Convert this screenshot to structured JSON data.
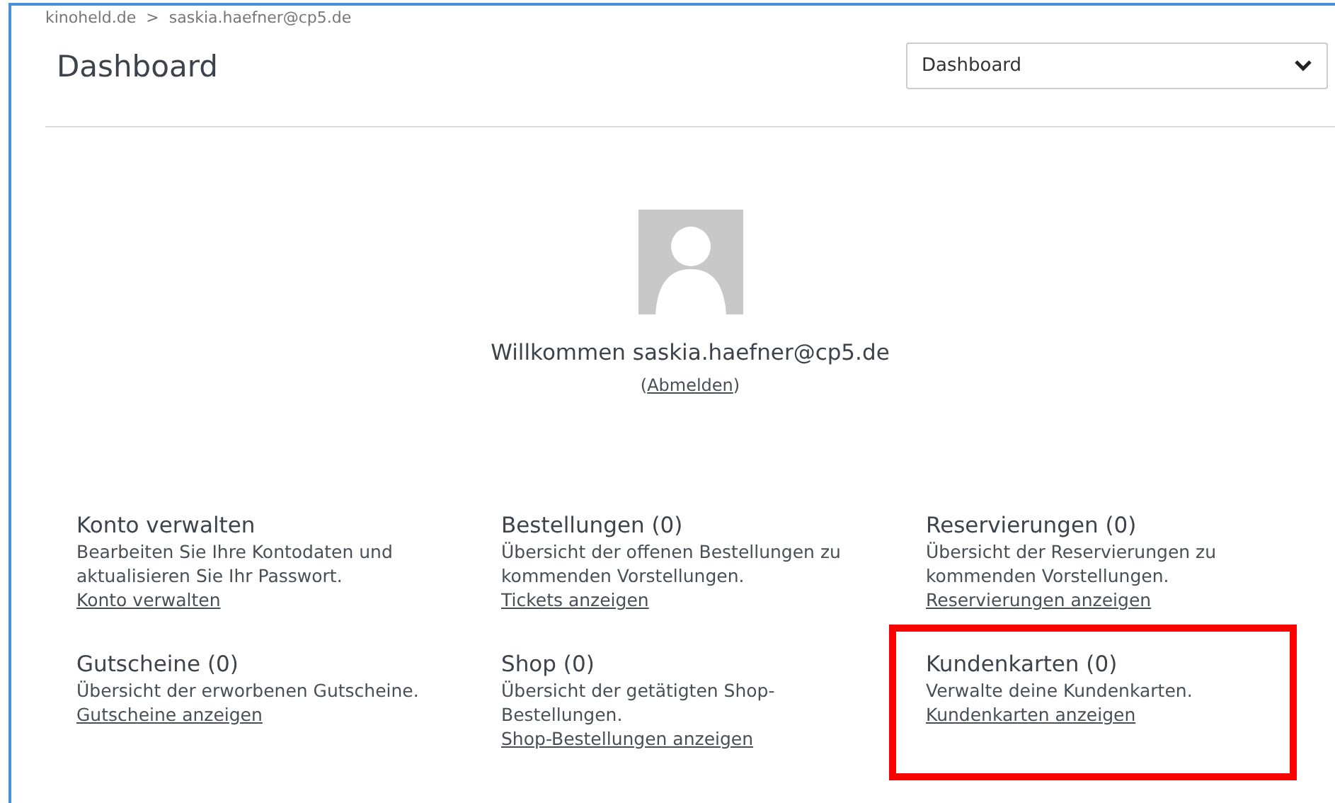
{
  "breadcrumb": [
    {
      "label": "kinoheld.de"
    },
    {
      "label": ">"
    },
    {
      "label": "saskia.haefner@cp5.de"
    }
  ],
  "title": "Dashboard",
  "page_select": {
    "value": "Dashboard"
  },
  "welcome": {
    "text": "Willkommen saskia.haefner@cp5.de",
    "logout_open": "(",
    "logout_link": "Abmelden",
    "logout_close": ")"
  },
  "cards": [
    {
      "title": "Konto verwalten",
      "text": "Bearbeiten Sie Ihre Kontodaten und aktualisieren Sie Ihr Passwort.",
      "link": "Konto verwalten",
      "highlighted": false
    },
    {
      "title": "Bestellungen (0)",
      "text": "Übersicht der offenen Bestellungen zu kommenden Vorstellungen.",
      "link": "Tickets anzeigen",
      "highlighted": false
    },
    {
      "title": "Reservierungen (0)",
      "text": "Übersicht der Reservierungen zu kommenden Vorstellungen.",
      "link": "Reservierungen anzeigen",
      "highlighted": false
    },
    {
      "title": "Gutscheine (0)",
      "text": "Übersicht der erworbenen Gutscheine.",
      "link": "Gutscheine anzeigen",
      "highlighted": false
    },
    {
      "title": "Shop (0)",
      "text": "Übersicht der getätigten Shop-Bestellungen.",
      "link": "Shop-Bestellungen anzeigen",
      "highlighted": false
    },
    {
      "title": "Kundenkarten (0)",
      "text": "Verwalte deine Kundenkarten.",
      "link": "Kundenkarten anzeigen",
      "highlighted": true
    }
  ]
}
